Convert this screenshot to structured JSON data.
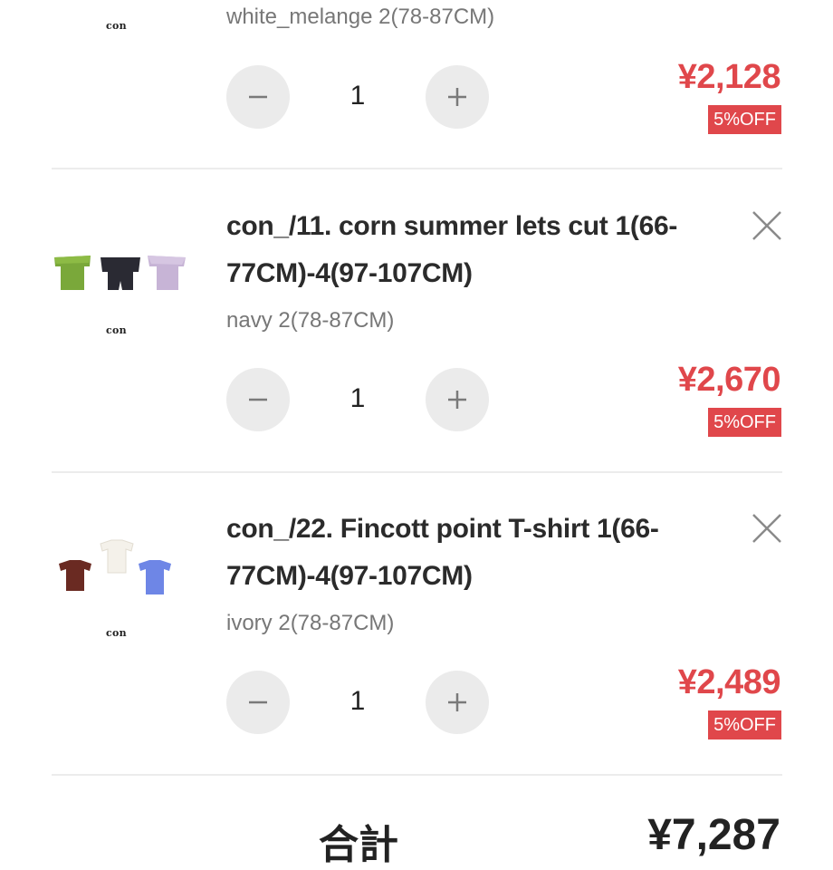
{
  "cart": {
    "items": [
      {
        "brand": "con",
        "title": "",
        "variant": "white_melange 2(78-87CM)",
        "quantity": "1",
        "price": "¥2,128",
        "discount_badge": "5%OFF"
      },
      {
        "brand": "con",
        "title": "con_/11. corn summer lets cut 1(66-77CM)-4(97-107CM)",
        "variant": "navy 2(78-87CM)",
        "quantity": "1",
        "price": "¥2,670",
        "discount_badge": "5%OFF"
      },
      {
        "brand": "con",
        "title": "con_/22. Fincott point T-shirt 1(66-77CM)-4(97-107CM)",
        "variant": "ivory 2(78-87CM)",
        "quantity": "1",
        "price": "¥2,489",
        "discount_badge": "5%OFF"
      }
    ],
    "total": {
      "label": "合計",
      "value": "¥7,287"
    }
  },
  "icons": {
    "minus": "minus-icon",
    "plus": "plus-icon",
    "remove": "close-icon"
  },
  "colors": {
    "price": "#e0474b",
    "badge_bg": "#e0474b",
    "stepper_bg": "#ebebeb",
    "icon_gray": "#8a8a8a"
  }
}
